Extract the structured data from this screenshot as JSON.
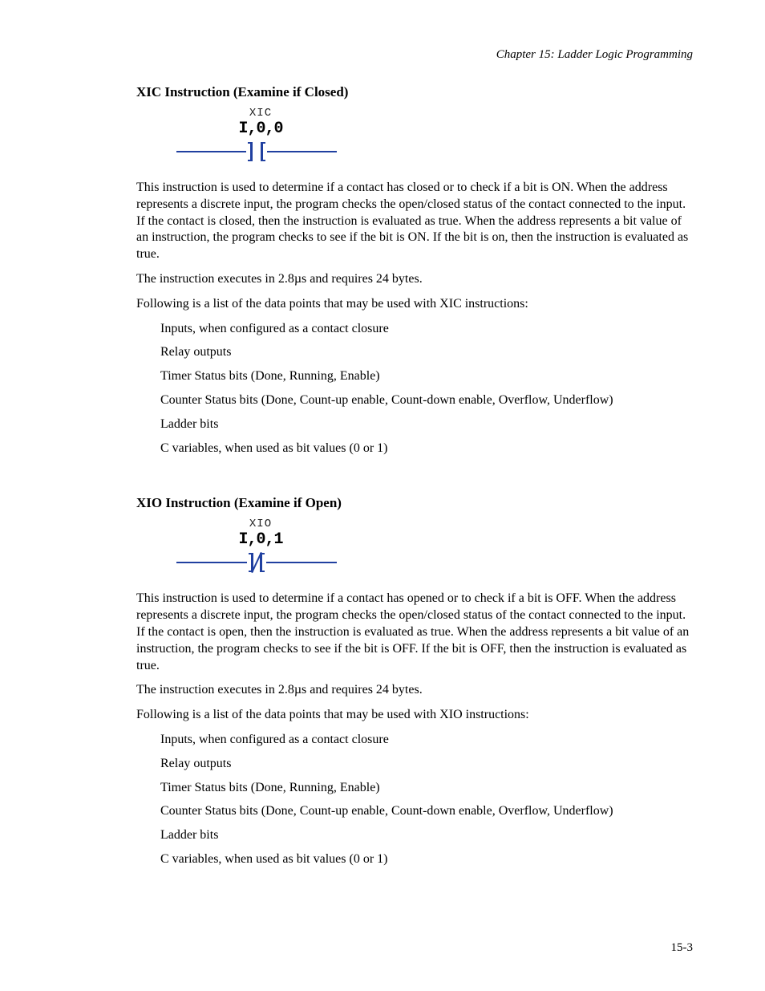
{
  "chapter_header": "Chapter 15: Ladder Logic Programming",
  "xic": {
    "heading": "XIC Instruction  (Examine if Closed)",
    "diagram_label": "XIC",
    "diagram_address": "I,0,0",
    "para1": "This instruction is used to determine if a contact has closed or to check if a bit is ON. When the address represents a discrete input, the program checks the open/closed status of the contact connected to the input. If the contact is closed, then the instruction is evaluated as true. When the address represents a bit value of an instruction, the program checks to see if the bit is ON. If the bit is on, then the instruction is evaluated as true.",
    "para2": "The instruction executes in 2.8µs and requires 24 bytes.",
    "para3": "Following is a list of the data points that may be used with XIC instructions:",
    "items": [
      "Inputs, when configured as a contact closure",
      "Relay outputs",
      "Timer Status bits (Done, Running, Enable)",
      "Counter Status bits (Done, Count-up enable, Count-down enable, Overflow, Underflow)",
      "Ladder bits",
      "C variables, when used as bit values (0 or 1)"
    ]
  },
  "xio": {
    "heading": "XIO Instruction  (Examine if Open)",
    "diagram_label": "XIO",
    "diagram_address": "I,0,1",
    "para1": "This instruction is used to determine if a contact has opened or to check if a bit is OFF. When the address represents a discrete input, the program checks the open/closed status of the contact connected to the input.  If the contact is open, then the instruction is evaluated as true. When the address represents a bit value of an instruction, the program checks to see if the bit is OFF.  If the bit is OFF, then the instruction is evaluated as true.",
    "para2": "The instruction executes in 2.8µs and requires 24 bytes.",
    "para3": "Following is a list of the data points that may be used with XIO instructions:",
    "items": [
      "Inputs, when configured as a contact closure",
      "Relay outputs",
      "Timer Status bits (Done, Running, Enable)",
      "Counter Status bits (Done, Count-up enable, Count-down enable, Overflow, Underflow)",
      "Ladder bits",
      "C variables, when used as bit values (0 or 1)"
    ]
  },
  "page_number": "15-3"
}
